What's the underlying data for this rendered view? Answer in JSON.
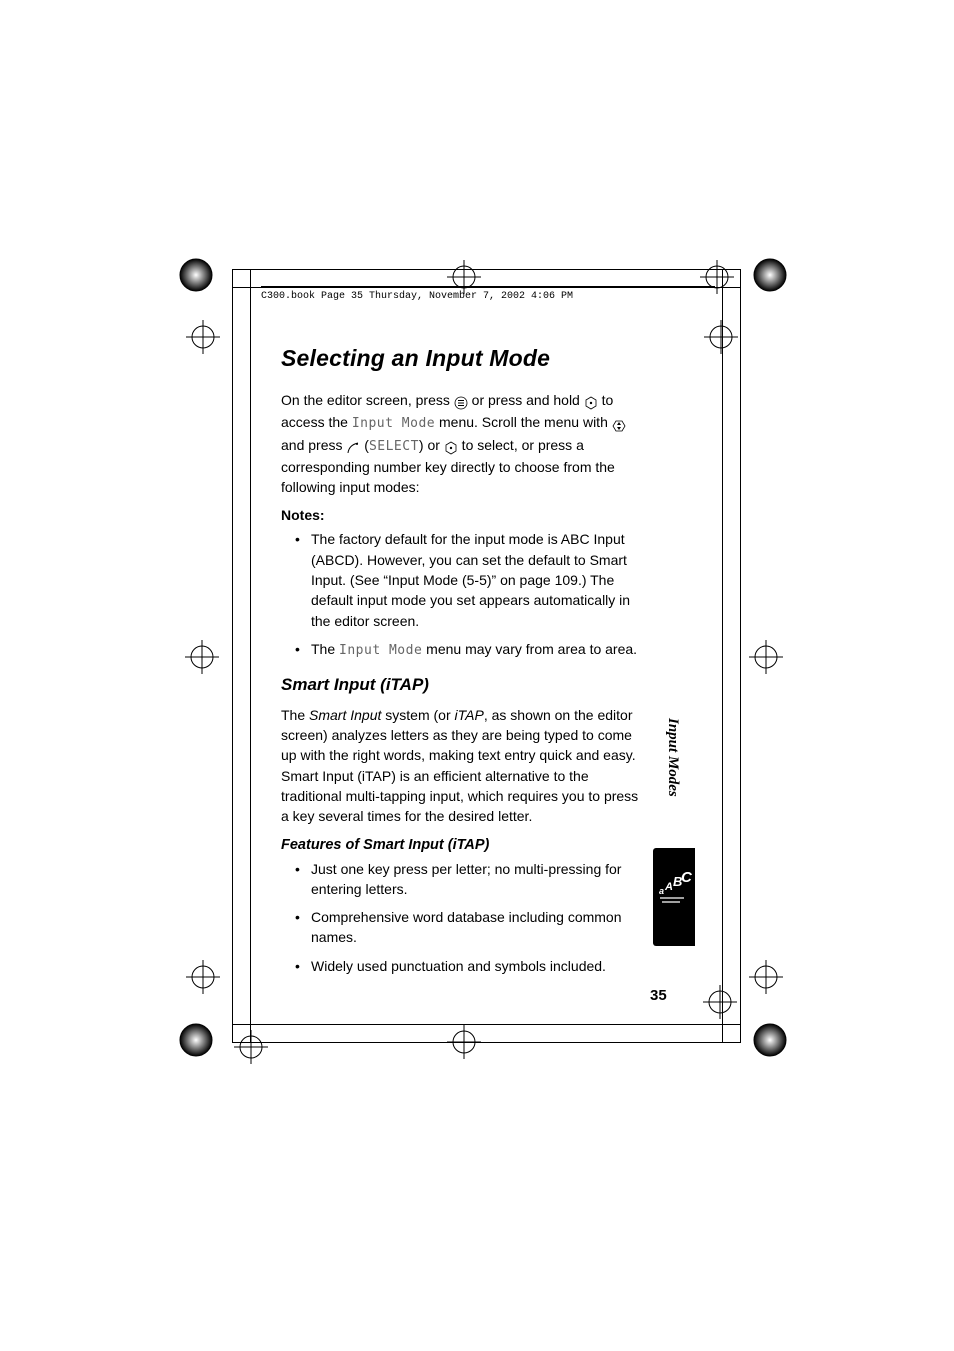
{
  "header": {
    "running_head": "C300.book  Page 35  Thursday, November 7, 2002  4:06 PM"
  },
  "title": "Selecting an Input Mode",
  "intro": {
    "p1a": "On the editor screen, press ",
    "p1b": " or press and hold ",
    "p1c": " to access the ",
    "input_mode_label": "Input Mode",
    "p1d": " menu. Scroll the menu with ",
    "p1e": " and press ",
    "select_label": "SELECT",
    "p1f": ") or ",
    "p1g": " to select, or press a corresponding number key directly to choose from the following input modes:",
    "open_paren": " ("
  },
  "notes_label": "Notes:",
  "notes": {
    "n1": "The factory default for the input mode is ABC Input (ABCD). However, you can set the default to Smart Input. (See “Input Mode (5-5)” on page 109.) The default input mode you set appears automatically in the editor screen.",
    "n2a": "The ",
    "n2_mono": "Input Mode",
    "n2b": " menu may vary from area to area."
  },
  "smart_heading": "Smart Input (iTAP)",
  "smart_para": {
    "a": "The ",
    "smart_input_ital": "Smart Input",
    "b": " system (or ",
    "itap_ital": "iTAP",
    "c": ", as shown on the editor screen) analyzes letters as they are being typed to come up with the right words, making text entry quick and easy. Smart Input (iTAP) is an efficient alternative to the traditional multi-tapping input, which requires you to press a key several times for the desired letter."
  },
  "features_heading": "Features of Smart Input (iTAP)",
  "features": {
    "f1": "Just one key press per letter; no multi-pressing for entering letters.",
    "f2": "Comprehensive word database including common names.",
    "f3": "Widely used punctuation and symbols included."
  },
  "side_label": "Input Modes",
  "page_number": "35"
}
